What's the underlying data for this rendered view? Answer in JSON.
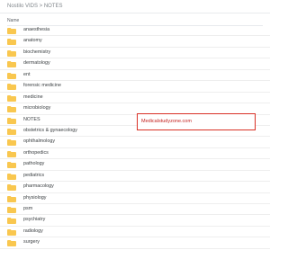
{
  "breadcrumb": "Nostilo VIDS > NOTES",
  "header": {
    "name_label": "Name"
  },
  "folder_color": "#f9c74f",
  "items": [
    "anaesthesia",
    "anatomy",
    "biochemistry",
    "dermatology",
    "ent",
    "forensic medicine",
    "medicine",
    "microbiology",
    "NOTES",
    "obstetrics & gynaecology",
    "ophthalmology",
    "orthopedics",
    "pathology",
    "pediatrics",
    "pharmacology",
    "physiology",
    "psm",
    "psychiatry",
    "radiology",
    "surgery"
  ],
  "watermark": {
    "text": "Medicalstudyzone.com",
    "border_color": "#d93025"
  }
}
